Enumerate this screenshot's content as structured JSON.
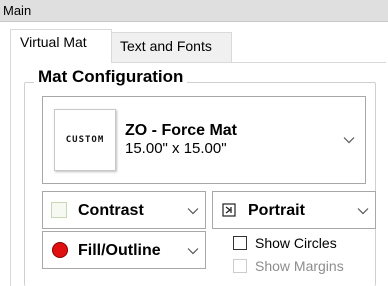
{
  "panel": {
    "title": "Main"
  },
  "tabs": [
    {
      "label": "Virtual Mat",
      "active": true
    },
    {
      "label": "Text and Fonts",
      "active": false
    }
  ],
  "mat_config": {
    "title": "Mat Configuration",
    "selected_mat": {
      "thumbnail_text": "CUSTOM",
      "name": "ZO - Force Mat",
      "size": "15.00\" x 15.00\""
    }
  },
  "contrast_dropdown": {
    "label": "Contrast",
    "icon": "contrast-swatch-icon"
  },
  "orientation_dropdown": {
    "label": "Portrait",
    "icon": "portrait-icon"
  },
  "fill_dropdown": {
    "label": "Fill/Outline",
    "icon": "red-circle-icon",
    "icon_color": "#e01010"
  },
  "checkboxes": {
    "show_circles": {
      "label": "Show Circles",
      "checked": false,
      "enabled": true
    },
    "show_margins": {
      "label": "Show Margins",
      "checked": false,
      "enabled": false
    }
  }
}
